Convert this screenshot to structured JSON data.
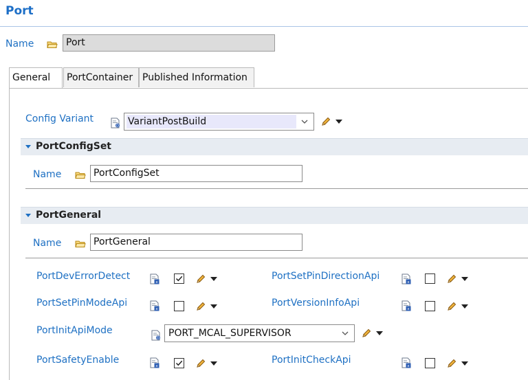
{
  "page": {
    "title": "Port"
  },
  "top_name": {
    "label": "Name",
    "value": "Port"
  },
  "tabs": [
    {
      "label": "General",
      "active": true
    },
    {
      "label": "PortContainer",
      "active": false
    },
    {
      "label": "Published Information",
      "active": false
    }
  ],
  "config_variant": {
    "label": "Config Variant",
    "value": "VariantPostBuild"
  },
  "port_config_set": {
    "title": "PortConfigSet",
    "name_label": "Name",
    "name_value": "PortConfigSet"
  },
  "port_general": {
    "title": "PortGeneral",
    "name_label": "Name",
    "name_value": "PortGeneral",
    "params": {
      "dev_error_detect": {
        "label": "PortDevErrorDetect",
        "checked": true
      },
      "set_pin_direction_api": {
        "label": "PortSetPinDirectionApi",
        "checked": false
      },
      "set_pin_mode_api": {
        "label": "PortSetPinModeApi",
        "checked": false
      },
      "version_info_api": {
        "label": "PortVersionInfoApi",
        "checked": false
      },
      "init_api_mode": {
        "label": "PortInitApiMode",
        "value": "PORT_MCAL_SUPERVISOR"
      },
      "safety_enable": {
        "label": "PortSafetyEnable",
        "checked": true
      },
      "init_check_api": {
        "label": "PortInitCheckApi",
        "checked": false
      }
    }
  },
  "colors": {
    "accent": "#1e70c3",
    "section_bar": "#e7ecf2",
    "selected_combo": "#e8e8fb"
  },
  "icons": {
    "folder": "folder-icon",
    "param_doc": "parameter-doc-icon",
    "edit": "pencil-icon",
    "menu": "dropdown-arrow-icon",
    "checkbox_checked": "checkmark-icon"
  }
}
